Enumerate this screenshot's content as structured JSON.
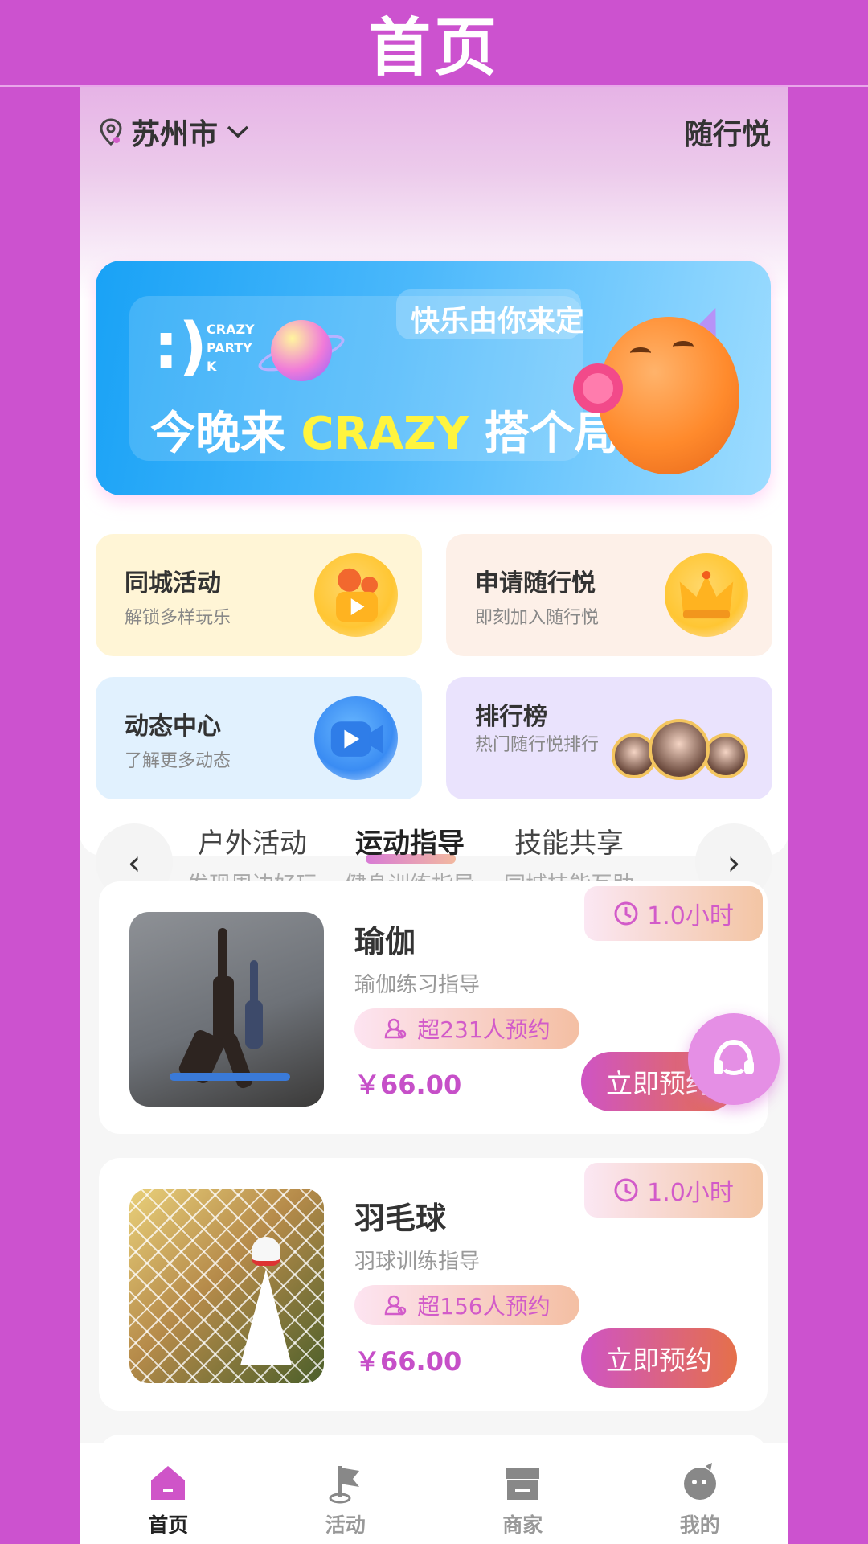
{
  "header": {
    "title": "首页"
  },
  "topbar": {
    "city": "苏州市",
    "brand": "随行悦"
  },
  "banner": {
    "smiley": ":)",
    "tagline": "快乐由你来定",
    "small_lines": [
      "CRAZY",
      "PARTY",
      "K"
    ],
    "main_prefix": "今晚来",
    "main_highlight": "CRAZY",
    "main_suffix": "搭个局吧!"
  },
  "feature_cards": [
    {
      "title": "同城活动",
      "subtitle": "解锁多样玩乐",
      "icon": "video-camera-icon"
    },
    {
      "title": "申请随行悦",
      "subtitle": "即刻加入随行悦",
      "icon": "crown-icon"
    },
    {
      "title": "动态中心",
      "subtitle": "了解更多动态",
      "icon": "play-camera-icon"
    },
    {
      "title": "排行榜",
      "subtitle": "热门随行悦排行",
      "icon": "ranking-avatars-icon"
    }
  ],
  "categories": [
    {
      "name": "户外活动",
      "desc": "发现周边好玩"
    },
    {
      "name": "运动指导",
      "desc": "健身训练指导",
      "selected": true
    },
    {
      "name": "技能共享",
      "desc": "同城技能互助"
    }
  ],
  "nav_arrows": {
    "prev": "‹",
    "next": "›"
  },
  "items": [
    {
      "title": "瑜伽",
      "subtitle": "瑜伽练习指导",
      "duration": "1.0小时",
      "booked": "超231人预约",
      "price": "￥66.00",
      "button": "立即预约"
    },
    {
      "title": "羽毛球",
      "subtitle": "羽球训练指导",
      "duration": "1.0小时",
      "booked": "超156人预约",
      "price": "￥66.00",
      "button": "立即预约"
    }
  ],
  "tabbar": [
    {
      "label": "首页",
      "icon": "home-icon",
      "active": true
    },
    {
      "label": "活动",
      "icon": "flag-icon"
    },
    {
      "label": "商家",
      "icon": "store-icon"
    },
    {
      "label": "我的",
      "icon": "profile-icon"
    }
  ],
  "colors": {
    "page_bg": "#cc52cf",
    "accent": "#d25bc9",
    "price": "#c64fc8"
  }
}
